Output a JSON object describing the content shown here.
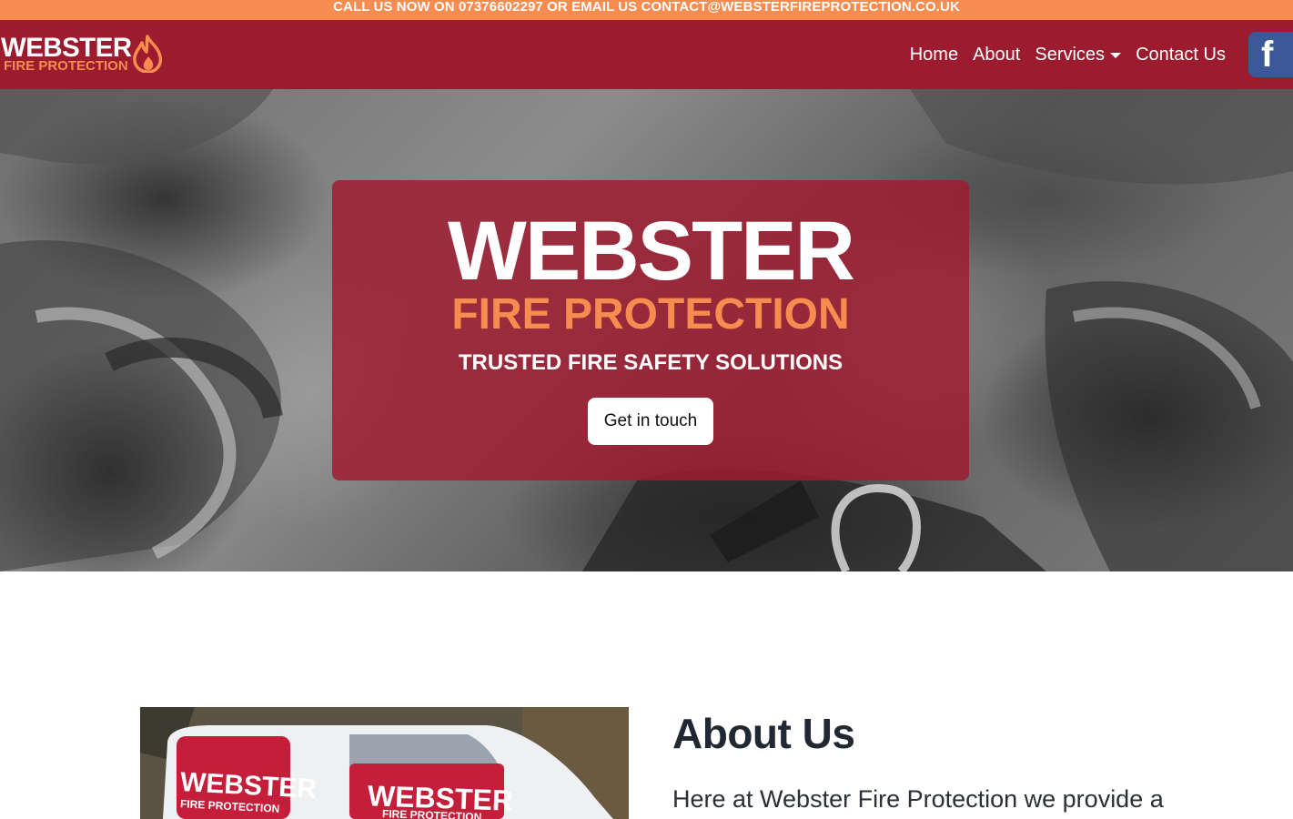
{
  "colors": {
    "brand_red": "#9c1b2e",
    "brand_orange": "#f68c4f",
    "facebook_blue": "#3b5998",
    "heading_dark": "#1f2833"
  },
  "topbar": {
    "text": "CALL US NOW ON 07376602297 OR EMAIL US CONTACT@WEBSTERFIREPROTECTION.CO.UK"
  },
  "logo": {
    "word": "WEBSTER",
    "sub": "FIRE PROTECTION",
    "icon": "flame-icon"
  },
  "nav": {
    "items": [
      {
        "label": "Home"
      },
      {
        "label": "About"
      },
      {
        "label": "Services",
        "dropdown": true
      },
      {
        "label": "Contact Us"
      }
    ],
    "social_icon": "facebook-icon",
    "social_glyph": "f"
  },
  "hero": {
    "title": "WEBSTER",
    "subtitle": "FIRE PROTECTION",
    "tagline": "TRUSTED FIRE SAFETY SOLUTIONS",
    "button_label": "Get in touch"
  },
  "about": {
    "heading": "About Us",
    "intro": "Here at Webster Fire Protection we provide a",
    "van_text": "WEBSTER",
    "van_sub": "FIRE PROTECTION"
  }
}
